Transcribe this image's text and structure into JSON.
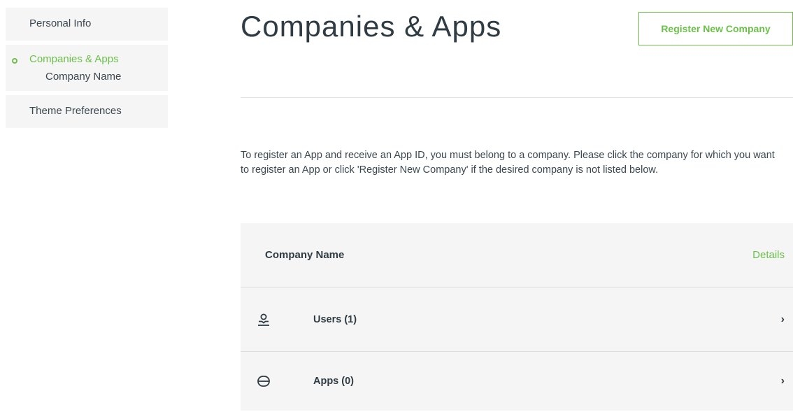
{
  "sidebar": {
    "items": [
      {
        "label": "Personal Info"
      },
      {
        "label": "Companies & Apps",
        "sub_label": "Company Name"
      },
      {
        "label": "Theme Preferences"
      }
    ]
  },
  "main": {
    "title": "Companies & Apps",
    "register_button": "Register New Company",
    "intro": "To register an App and receive an App ID, you must belong to a company. Please click the company for which you want to register an App or click 'Register New Company' if the desired company is not listed below.",
    "card": {
      "company_name": "Company Name",
      "details_link": "Details",
      "rows": [
        {
          "label": "Users (1)",
          "icon": "user-icon"
        },
        {
          "label": "Apps (0)",
          "icon": "app-icon"
        }
      ]
    }
  },
  "colors": {
    "accent": "#6cc04a",
    "panel": "#f5f5f5",
    "text": "#2f3c44"
  }
}
